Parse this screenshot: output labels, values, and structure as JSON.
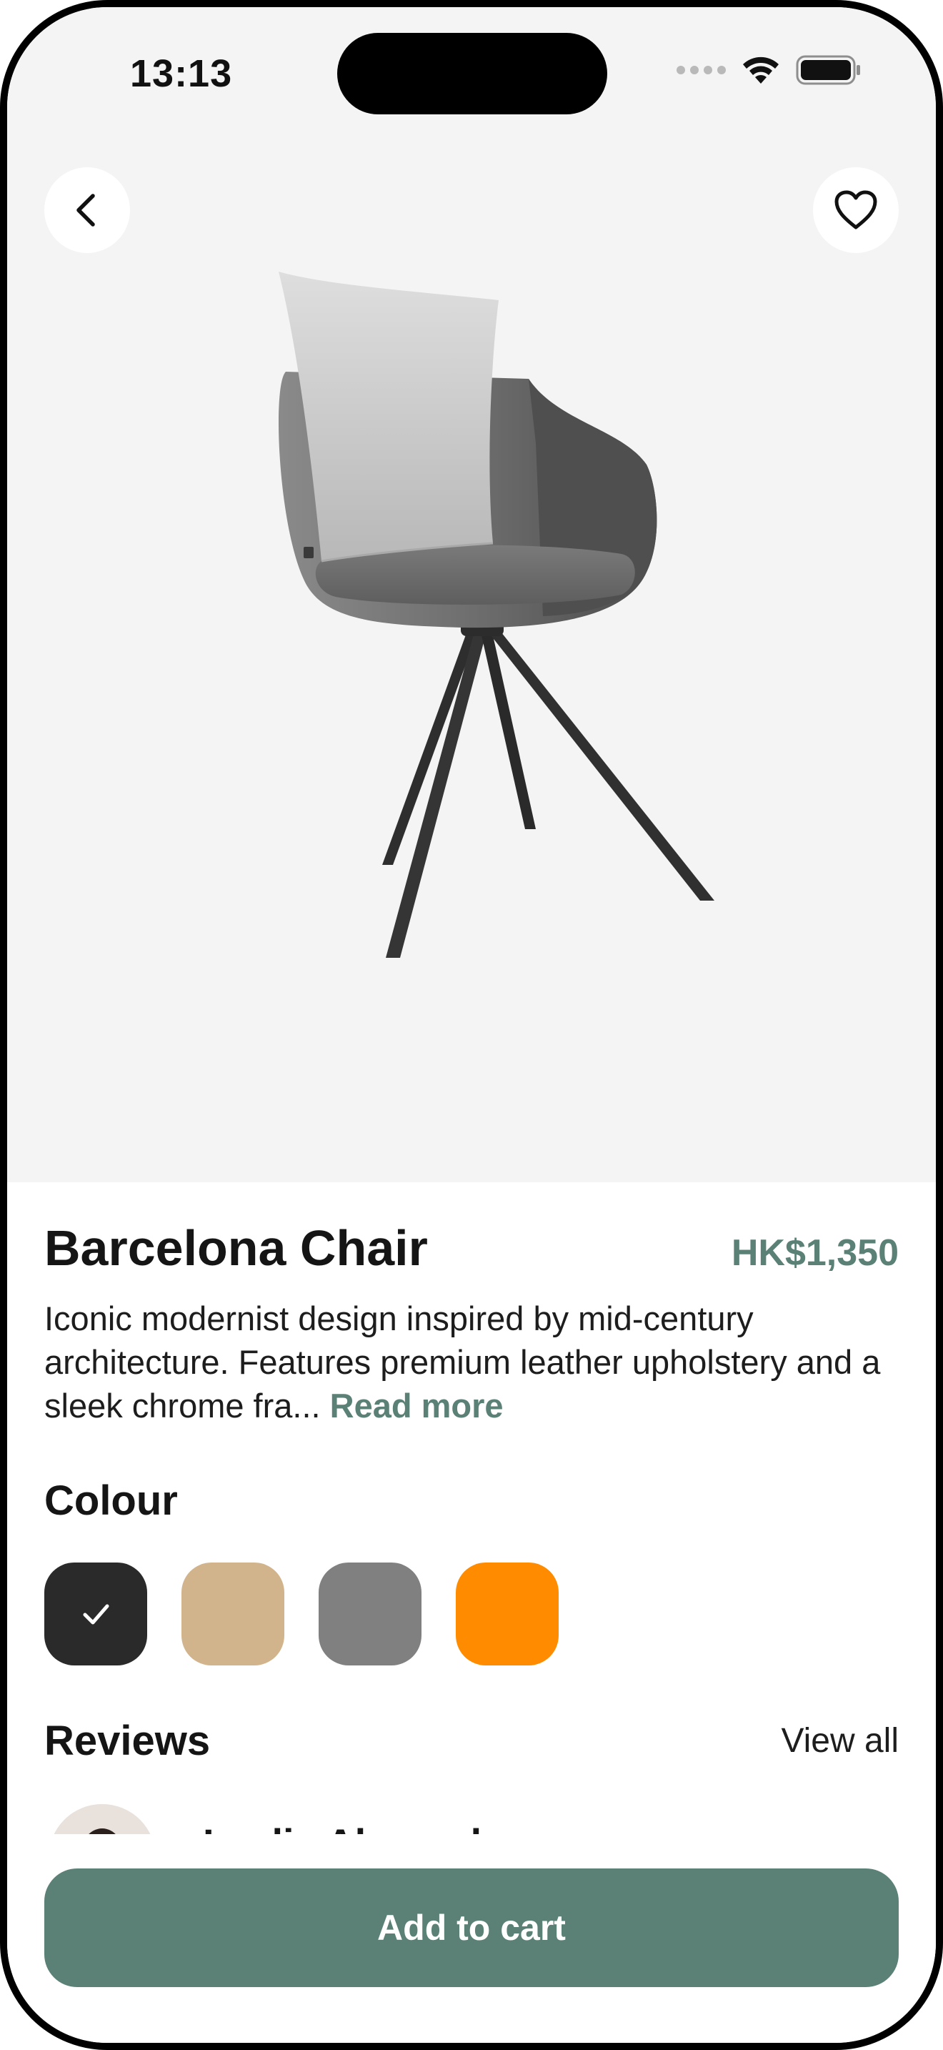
{
  "status_bar": {
    "time": "13:13",
    "icons": [
      "cellular-signal-icon",
      "wifi-icon",
      "battery-icon"
    ]
  },
  "header": {
    "back_icon": "chevron-left-icon",
    "favorite_icon": "heart-outline-icon"
  },
  "product": {
    "title": "Barcelona Chair",
    "price": "HK$1,350",
    "description": "Iconic modernist design inspired by mid-century architecture. Features premium leather upholstery and a sleek chrome fra...",
    "read_more": "Read more"
  },
  "colour": {
    "heading": "Colour",
    "swatches": [
      {
        "name": "black",
        "hex": "#2a2a2a",
        "selected": true
      },
      {
        "name": "tan",
        "hex": "#d2b48c",
        "selected": false
      },
      {
        "name": "grey",
        "hex": "#808080",
        "selected": false
      },
      {
        "name": "orange",
        "hex": "#ff8c00",
        "selected": false
      }
    ]
  },
  "reviews": {
    "heading": "Reviews",
    "view_all": "View all",
    "first_reviewer": "Leslie Alexander"
  },
  "cart": {
    "button_label": "Add to cart"
  },
  "colors": {
    "accent": "#5b8076",
    "hero_background": "#f4f4f4",
    "text": "#151515"
  }
}
